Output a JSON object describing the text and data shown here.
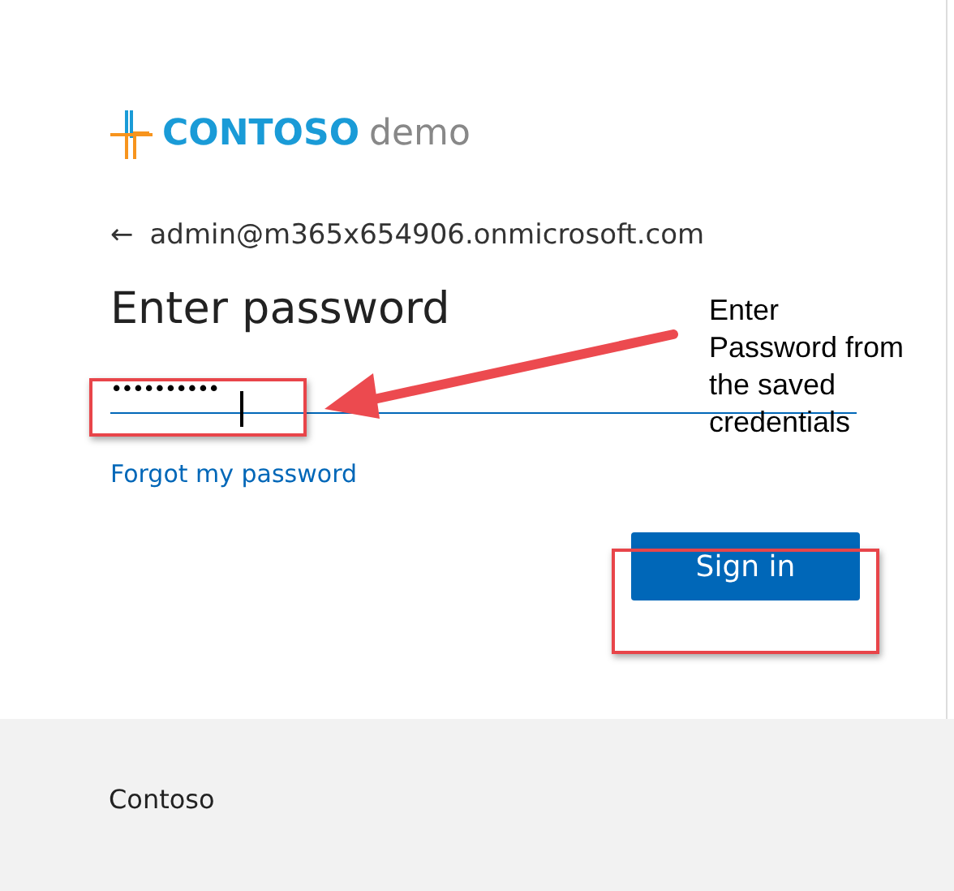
{
  "logo": {
    "brand": "CONTOSO",
    "suffix": "demo"
  },
  "back": {
    "icon": "←",
    "email": "admin@m365x654906.onmicrosoft.com"
  },
  "heading": "Enter password",
  "password": {
    "value": "••••••••••"
  },
  "forgot_link": "Forgot my password",
  "sign_in_button": "Sign in",
  "footer": {
    "text": "Contoso"
  },
  "annotation": {
    "text": "Enter\nPassword from\nthe saved\ncredentials"
  }
}
